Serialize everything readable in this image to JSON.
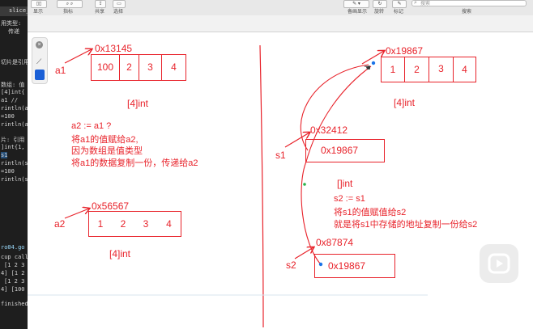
{
  "toolbar": {
    "labels": [
      "显示",
      "指标",
      "共享",
      "选择",
      "备画显示",
      "旋转",
      "标记",
      "搜索"
    ],
    "search_placeholder": "搜索"
  },
  "code_panel": {
    "tab": "slice_d",
    "lines": [
      "用类型:",
      "传递",
      "切片是引用",
      "数组: 值",
      "[4]int{",
      "a1 //",
      "rintln(a",
      "=100",
      "rintln(a",
      "片: 引用",
      "]int{1,",
      "s1",
      "rintln(s",
      "=100",
      "rintln(s",
      "ro04.go",
      "cup call",
      "[1 2 3",
      "4] [1 2",
      "[1 2 3",
      "4] [100",
      "finished"
    ]
  },
  "annotations": {
    "a1_label": "a1",
    "a1_addr": "0x13145",
    "a1_values": [
      "100",
      "2",
      "3",
      "4"
    ],
    "a1_type": "[4]int",
    "note1": [
      "a2 := a1 ?",
      "将a1的值赋给a2,",
      "因为数组是值类型",
      "将a1的数据复制一份，传递给a2"
    ],
    "a2_label": "a2",
    "a2_addr": "0x56567",
    "a2_values": [
      "1",
      "2",
      "3",
      "4"
    ],
    "a2_type": "[4]int",
    "right_addr": "0x19867",
    "right_values": [
      "1",
      "2",
      "3",
      "4"
    ],
    "right_type": "[4]int",
    "s1_label": "s1",
    "s1_addr": "0x32412",
    "s1_value": "0x19867",
    "slice_type": "[]int",
    "note2": [
      "s2 := s1",
      "将s1的值赋值给s2",
      "就是将s1中存储的地址复制一份给s2"
    ],
    "s2_label": "s2",
    "s2_addr": "0x87874",
    "s2_value": "0x19867"
  },
  "colors": {
    "ink": "#e8222a",
    "accent": "#1a73e8"
  }
}
